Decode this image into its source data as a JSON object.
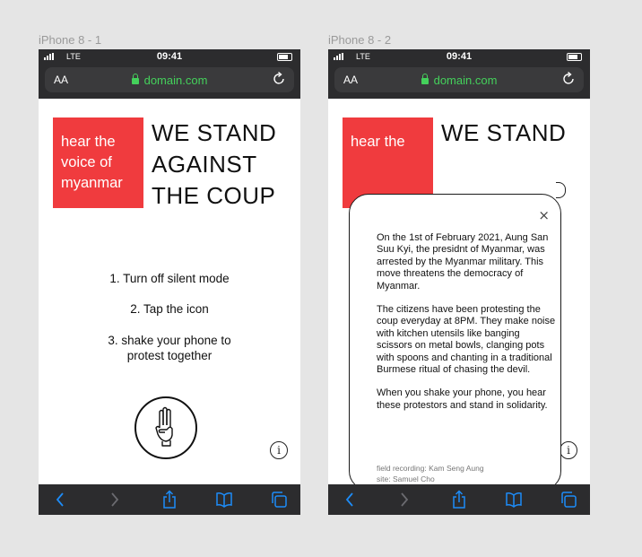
{
  "frames": [
    {
      "label": "iPhone 8 - 1",
      "status": {
        "carrier": "LTE",
        "time": "09:41"
      },
      "browser": {
        "text_size_label": "AA",
        "url": "domain.com"
      },
      "red_box_text": [
        "hear the",
        "voice of",
        "myanmar"
      ],
      "headline": [
        "WE STAND",
        "AGAINST",
        "THE COUP"
      ],
      "instructions": [
        "1. Turn off silent mode",
        "2. Tap the icon",
        "3. shake your phone to",
        "protest together"
      ],
      "info_label": "i"
    },
    {
      "label": "iPhone 8 - 2",
      "status": {
        "carrier": "LTE",
        "time": "09:41"
      },
      "browser": {
        "text_size_label": "AA",
        "url": "domain.com"
      },
      "red_box_text": [
        "hear the"
      ],
      "headline": [
        "WE STAND"
      ],
      "info_label": "i",
      "popup": {
        "close": "×",
        "paragraphs": [
          "On the 1st of February 2021, Aung San Suu Kyi, the presidnt of Myanmar, was arrested by the Myanmar military. This move threatens the democracy of Myanmar.",
          "The citizens have been protesting the coup everyday at 8PM. They make noise with kitchen utensils like banging scissors on metal bowls, clanging pots with spoons and chanting in a traditional Burmese ritual of chasing the devil.",
          "When you shake your phone, you hear these protestors and stand in solidarity."
        ],
        "credits": [
          "field recording: Kam Seng Aung",
          "site: Samuel Cho"
        ]
      }
    }
  ],
  "toolbar_icons": [
    "back-icon",
    "forward-icon",
    "share-icon",
    "bookmarks-icon",
    "tabs-icon"
  ],
  "colors": {
    "accent_red": "#f03b3e",
    "url_green": "#44d15b",
    "toolbar_blue": "#1d8cf8",
    "chrome_dark": "#2c2c2e"
  }
}
